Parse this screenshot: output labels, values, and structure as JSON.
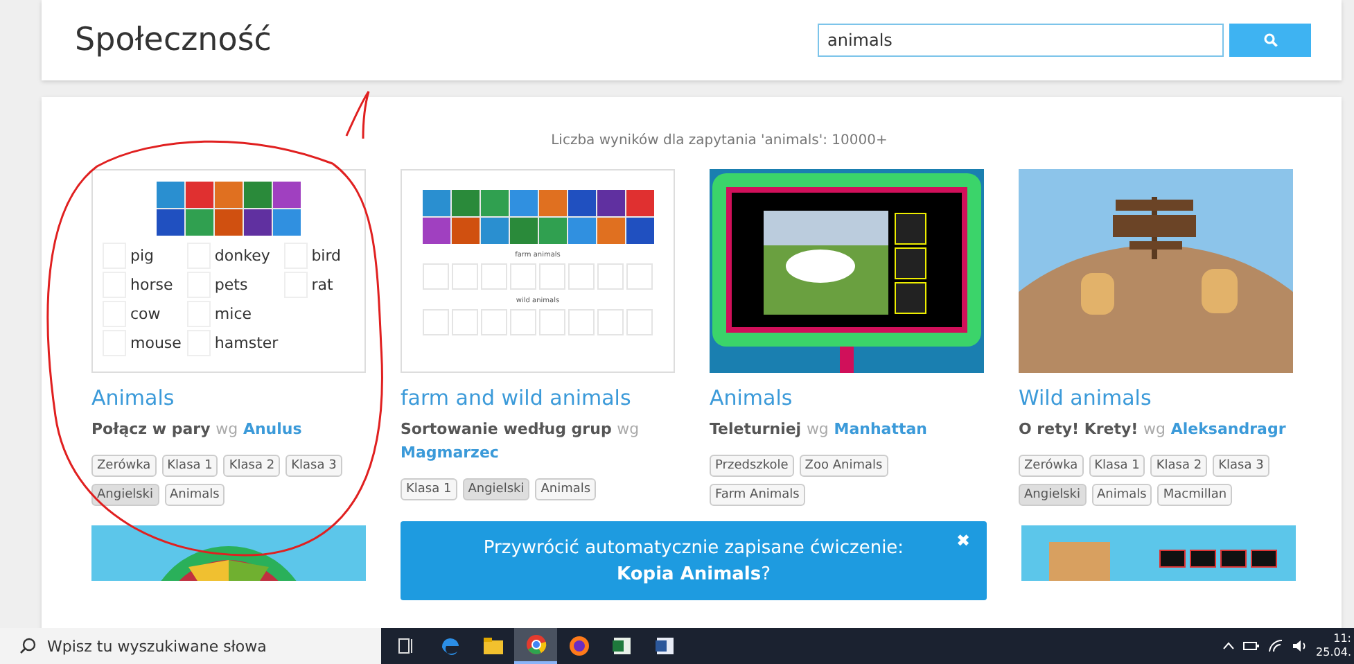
{
  "header": {
    "title": "Społeczność",
    "search": {
      "value": "animals"
    }
  },
  "results_count": "Liczba wyników dla zapytania 'animals': 10000+",
  "cards": [
    {
      "title": "Animals",
      "type": "Połącz w pary",
      "by": "wg",
      "author": "Anulus",
      "thumbnail": {
        "kind": "match",
        "columns": [
          [
            "pig",
            "horse",
            "cow",
            "mouse"
          ],
          [
            "donkey",
            "pets",
            "mice",
            "hamster"
          ],
          [
            "bird",
            "rat"
          ]
        ]
      },
      "tags": [
        {
          "label": "Zerówka",
          "highlighted": false
        },
        {
          "label": "Klasa 1",
          "highlighted": false
        },
        {
          "label": "Klasa 2",
          "highlighted": false
        },
        {
          "label": "Klasa 3",
          "highlighted": false
        },
        {
          "label": "Angielski",
          "highlighted": true
        },
        {
          "label": "Animals",
          "highlighted": false
        }
      ]
    },
    {
      "title": "farm and wild animals",
      "type": "Sortowanie według grup",
      "by": "wg",
      "author": "Magmarzec",
      "thumbnail": {
        "kind": "groups",
        "groups": [
          "farm animals",
          "wild animals"
        ]
      },
      "tags": [
        {
          "label": "Klasa 1",
          "highlighted": false
        },
        {
          "label": "Angielski",
          "highlighted": true
        },
        {
          "label": "Animals",
          "highlighted": false
        }
      ]
    },
    {
      "title": "Animals",
      "type": "Teleturniej",
      "by": "wg",
      "author": "Manhattan",
      "thumbnail": {
        "kind": "quiz"
      },
      "tags": [
        {
          "label": "Przedszkole",
          "highlighted": false
        },
        {
          "label": "Zoo Animals",
          "highlighted": false
        },
        {
          "label": "Farm Animals",
          "highlighted": false
        }
      ]
    },
    {
      "title": "Wild animals",
      "type": "O rety! Krety!",
      "by": "wg",
      "author": "Aleksandragr",
      "thumbnail": {
        "kind": "moles"
      },
      "tags": [
        {
          "label": "Zerówka",
          "highlighted": false
        },
        {
          "label": "Klasa 1",
          "highlighted": false
        },
        {
          "label": "Klasa 2",
          "highlighted": false
        },
        {
          "label": "Klasa 3",
          "highlighted": false
        },
        {
          "label": "Angielski",
          "highlighted": true
        },
        {
          "label": "Animals",
          "highlighted": false
        },
        {
          "label": "Macmillan",
          "highlighted": false
        }
      ]
    }
  ],
  "more_cards": [
    {
      "kind": "wheel"
    },
    {
      "kind": "cat"
    }
  ],
  "restore_banner": {
    "text": "Przywrócić automatycznie zapisane ćwiczenie: **Kopia Animals**?",
    "close": "✖"
  },
  "taskbar": {
    "search_placeholder": "Wpisz tu wyszukiwane słowa",
    "apps": [
      {
        "kind": "taskview",
        "active": false
      },
      {
        "kind": "edge",
        "active": false
      },
      {
        "kind": "files",
        "active": false
      },
      {
        "kind": "chrome",
        "active": true
      },
      {
        "kind": "firefox",
        "active": false
      },
      {
        "kind": "excel",
        "active": false
      },
      {
        "kind": "word",
        "active": false
      }
    ],
    "time": "11:",
    "date": "25.04."
  }
}
